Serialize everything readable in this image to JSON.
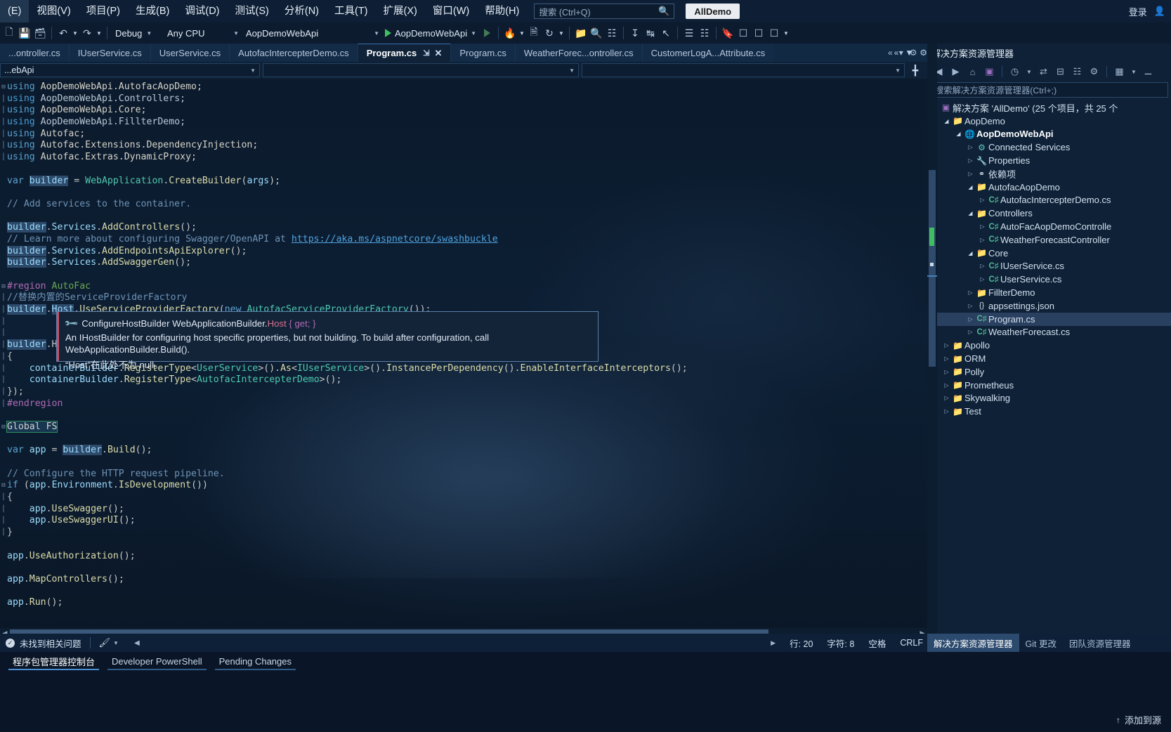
{
  "menu": {
    "items": [
      "(E)",
      "视图(V)",
      "项目(P)",
      "生成(B)",
      "调试(D)",
      "测试(S)",
      "分析(N)",
      "工具(T)",
      "扩展(X)",
      "窗口(W)",
      "帮助(H)"
    ],
    "search_placeholder": "搜索 (Ctrl+Q)",
    "search_icon": "search-icon",
    "alldemo_label": "AllDemo",
    "login_label": "登录",
    "account_icon": "account-icon"
  },
  "toolbar": {
    "config": "Debug",
    "platform": "Any CPU",
    "startup_project": "AopDemoWebApi",
    "run_label": "AopDemoWebApi",
    "icons": [
      "new-file-icon",
      "save-icon",
      "save-all-icon",
      "undo-icon",
      "redo-icon",
      "start-icon",
      "start-no-debug-icon",
      "hot-reload-icon",
      "layout-icon",
      "refresh-icon",
      "folder-icon",
      "find-icon",
      "window-icon"
    ]
  },
  "tabs": [
    {
      "label": "...ontroller.cs",
      "active": false
    },
    {
      "label": "IUserService.cs",
      "active": false
    },
    {
      "label": "UserService.cs",
      "active": false
    },
    {
      "label": "AutofacIntercepterDemo.cs",
      "active": false
    },
    {
      "label": "Program.cs",
      "active": true
    },
    {
      "label": "Program.cs",
      "active": false
    },
    {
      "label": "WeatherForec...ontroller.cs",
      "active": false
    },
    {
      "label": "CustomerLogA...Attribute.cs",
      "active": false
    }
  ],
  "tab_controls": {
    "overflow": "«",
    "dropdown": "▾",
    "settings": "⚙"
  },
  "navbar": {
    "type_value": "...ebApi",
    "member_value": "",
    "method_value": "",
    "add_icon": "split-view-icon"
  },
  "code_lines": [
    {
      "glyph": "minus",
      "tokens": [
        {
          "t": "using ",
          "c": "k"
        },
        {
          "t": "AopDemoWebApi.AutofacAopDemo;",
          "c": "ns"
        }
      ]
    },
    {
      "glyph": "bar",
      "tokens": [
        {
          "t": "using ",
          "c": "kw2"
        },
        {
          "t": "AopDemoWebApi.Controllers;",
          "c": "ns2"
        }
      ]
    },
    {
      "glyph": "bar",
      "tokens": [
        {
          "t": "using ",
          "c": "k"
        },
        {
          "t": "AopDemoWebApi.Core;",
          "c": "ns"
        }
      ]
    },
    {
      "glyph": "bar",
      "tokens": [
        {
          "t": "using ",
          "c": "kw2"
        },
        {
          "t": "AopDemoWebApi.FillterDemo;",
          "c": "ns2"
        }
      ]
    },
    {
      "glyph": "bar",
      "tokens": [
        {
          "t": "using ",
          "c": "k"
        },
        {
          "t": "Autofac;",
          "c": "ns"
        }
      ]
    },
    {
      "glyph": "bar",
      "tokens": [
        {
          "t": "using ",
          "c": "k"
        },
        {
          "t": "Autofac.Extensions.DependencyInjection;",
          "c": "ns"
        }
      ]
    },
    {
      "glyph": "bar",
      "tokens": [
        {
          "t": "using ",
          "c": "k"
        },
        {
          "t": "Autofac.Extras.DynamicProxy;",
          "c": "ns"
        }
      ]
    },
    {
      "glyph": "",
      "tokens": []
    },
    {
      "glyph": "",
      "tokens": [
        {
          "t": "var ",
          "c": "k"
        },
        {
          "t": "builder",
          "c": "hl id"
        },
        {
          "t": " = ",
          "c": "pl"
        },
        {
          "t": "WebApplication",
          "c": "typ"
        },
        {
          "t": ".",
          "c": "pl"
        },
        {
          "t": "CreateBuilder",
          "c": "mth"
        },
        {
          "t": "(",
          "c": "pl"
        },
        {
          "t": "args",
          "c": "id"
        },
        {
          "t": ");",
          "c": "pl"
        }
      ]
    },
    {
      "glyph": "",
      "tokens": []
    },
    {
      "glyph": "",
      "tokens": [
        {
          "t": "// Add services to the container.",
          "c": "cm"
        }
      ]
    },
    {
      "glyph": "",
      "tokens": []
    },
    {
      "glyph": "",
      "tokens": [
        {
          "t": "builder",
          "c": "hl id"
        },
        {
          "t": ".",
          "c": "pl"
        },
        {
          "t": "Services",
          "c": "id"
        },
        {
          "t": ".",
          "c": "pl"
        },
        {
          "t": "AddControllers",
          "c": "mth"
        },
        {
          "t": "();",
          "c": "pl"
        }
      ]
    },
    {
      "glyph": "",
      "tokens": [
        {
          "t": "// Learn more about configuring Swagger/OpenAPI at ",
          "c": "cm"
        },
        {
          "t": "https://aka.ms/aspnetcore/swashbuckle",
          "c": "lnk"
        }
      ]
    },
    {
      "glyph": "",
      "tokens": [
        {
          "t": "builder",
          "c": "hl id"
        },
        {
          "t": ".",
          "c": "pl"
        },
        {
          "t": "Services",
          "c": "id"
        },
        {
          "t": ".",
          "c": "pl"
        },
        {
          "t": "AddEndpointsApiExplorer",
          "c": "mth"
        },
        {
          "t": "();",
          "c": "pl"
        }
      ]
    },
    {
      "glyph": "",
      "tokens": [
        {
          "t": "builder",
          "c": "hl id"
        },
        {
          "t": ".",
          "c": "pl"
        },
        {
          "t": "Services",
          "c": "id"
        },
        {
          "t": ".",
          "c": "pl"
        },
        {
          "t": "AddSwaggerGen",
          "c": "mth"
        },
        {
          "t": "();",
          "c": "pl"
        }
      ]
    },
    {
      "glyph": "",
      "tokens": []
    },
    {
      "glyph": "minus",
      "tokens": [
        {
          "t": "#region ",
          "c": "pp"
        },
        {
          "t": "AutoFac",
          "c": "ppg"
        }
      ]
    },
    {
      "glyph": "bar",
      "tokens": [
        {
          "t": "//替换内置的ServiceProviderFactory",
          "c": "cm"
        }
      ]
    },
    {
      "glyph": "bar",
      "tokens": [
        {
          "t": "builder",
          "c": "hl id"
        },
        {
          "t": ".",
          "c": "pl"
        },
        {
          "t": "Host",
          "c": "hl id"
        },
        {
          "t": ".",
          "c": "pl"
        },
        {
          "t": "UseServiceProviderFactory",
          "c": "mth"
        },
        {
          "t": "(",
          "c": "pl"
        },
        {
          "t": "new ",
          "c": "k"
        },
        {
          "t": "AutofacServiceProviderFactory",
          "c": "typ"
        },
        {
          "t": "());",
          "c": "pl"
        }
      ]
    },
    {
      "glyph": "bar",
      "tokens": []
    },
    {
      "glyph": "bar",
      "tokens": []
    },
    {
      "glyph": "bar",
      "tokens": [
        {
          "t": "builder",
          "c": "hl id"
        },
        {
          "t": ".H",
          "c": "pl"
        }
      ]
    },
    {
      "glyph": "bar",
      "tokens": [
        {
          "t": "{",
          "c": "pl"
        }
      ]
    },
    {
      "glyph": "bar",
      "tokens": [
        {
          "t": "    containerBuilder",
          "c": "id"
        },
        {
          "t": ".",
          "c": "pl"
        },
        {
          "t": "RegisterType",
          "c": "mth"
        },
        {
          "t": "<",
          "c": "pl"
        },
        {
          "t": "UserService",
          "c": "typ"
        },
        {
          "t": ">().",
          "c": "pl"
        },
        {
          "t": "As",
          "c": "mth"
        },
        {
          "t": "<",
          "c": "pl"
        },
        {
          "t": "IUserService",
          "c": "typ"
        },
        {
          "t": ">().",
          "c": "pl"
        },
        {
          "t": "InstancePerDependency",
          "c": "mth"
        },
        {
          "t": "().",
          "c": "pl"
        },
        {
          "t": "EnableInterfaceInterceptors",
          "c": "mth"
        },
        {
          "t": "();",
          "c": "pl"
        }
      ]
    },
    {
      "glyph": "bar",
      "tokens": [
        {
          "t": "    containerBuilder",
          "c": "id"
        },
        {
          "t": ".",
          "c": "pl"
        },
        {
          "t": "RegisterType",
          "c": "mth"
        },
        {
          "t": "<",
          "c": "pl"
        },
        {
          "t": "AutofacIntercepterDemo",
          "c": "typ"
        },
        {
          "t": ">();",
          "c": "pl"
        }
      ]
    },
    {
      "glyph": "bar",
      "tokens": [
        {
          "t": "});",
          "c": "pl"
        }
      ]
    },
    {
      "glyph": "bar",
      "tokens": [
        {
          "t": "#endregion",
          "c": "pp"
        }
      ]
    },
    {
      "glyph": "",
      "tokens": []
    },
    {
      "glyph": "minus",
      "tokens": [
        {
          "t": "Global FS",
          "c": "sel"
        }
      ]
    },
    {
      "glyph": "",
      "tokens": []
    },
    {
      "glyph": "",
      "tokens": [
        {
          "t": "var ",
          "c": "k"
        },
        {
          "t": "app",
          "c": "id"
        },
        {
          "t": " = ",
          "c": "pl"
        },
        {
          "t": "builder",
          "c": "hl id"
        },
        {
          "t": ".",
          "c": "pl"
        },
        {
          "t": "Build",
          "c": "mth"
        },
        {
          "t": "();",
          "c": "pl"
        }
      ]
    },
    {
      "glyph": "",
      "tokens": []
    },
    {
      "glyph": "",
      "tokens": [
        {
          "t": "// Configure the HTTP request pipeline.",
          "c": "cm"
        }
      ]
    },
    {
      "glyph": "minus",
      "tokens": [
        {
          "t": "if ",
          "c": "k"
        },
        {
          "t": "(",
          "c": "pl"
        },
        {
          "t": "app",
          "c": "id"
        },
        {
          "t": ".",
          "c": "pl"
        },
        {
          "t": "Environment",
          "c": "id"
        },
        {
          "t": ".",
          "c": "pl"
        },
        {
          "t": "IsDevelopment",
          "c": "mth"
        },
        {
          "t": "())",
          "c": "pl"
        }
      ]
    },
    {
      "glyph": "bar",
      "tokens": [
        {
          "t": "{",
          "c": "pl"
        }
      ]
    },
    {
      "glyph": "bar",
      "tokens": [
        {
          "t": "    app",
          "c": "id"
        },
        {
          "t": ".",
          "c": "pl"
        },
        {
          "t": "UseSwagger",
          "c": "mth"
        },
        {
          "t": "();",
          "c": "pl"
        }
      ]
    },
    {
      "glyph": "bar",
      "tokens": [
        {
          "t": "    app",
          "c": "id"
        },
        {
          "t": ".",
          "c": "pl"
        },
        {
          "t": "UseSwaggerUI",
          "c": "mth"
        },
        {
          "t": "();",
          "c": "pl"
        }
      ]
    },
    {
      "glyph": "bar",
      "tokens": [
        {
          "t": "}",
          "c": "pl"
        }
      ]
    },
    {
      "glyph": "",
      "tokens": []
    },
    {
      "glyph": "",
      "tokens": [
        {
          "t": "app",
          "c": "id"
        },
        {
          "t": ".",
          "c": "pl"
        },
        {
          "t": "UseAuthorization",
          "c": "mth"
        },
        {
          "t": "();",
          "c": "pl"
        }
      ]
    },
    {
      "glyph": "",
      "tokens": []
    },
    {
      "glyph": "",
      "tokens": [
        {
          "t": "app",
          "c": "id"
        },
        {
          "t": ".",
          "c": "pl"
        },
        {
          "t": "MapControllers",
          "c": "mth"
        },
        {
          "t": "();",
          "c": "pl"
        }
      ]
    },
    {
      "glyph": "",
      "tokens": []
    },
    {
      "glyph": "",
      "tokens": [
        {
          "t": "app",
          "c": "id"
        },
        {
          "t": ".",
          "c": "pl"
        },
        {
          "t": "Run",
          "c": "mth"
        },
        {
          "t": "();",
          "c": "pl"
        }
      ]
    }
  ],
  "tooltip": {
    "icon": "wrench-icon",
    "signature_prefix": "ConfigureHostBuilder WebApplicationBuilder.",
    "signature_host": "Host",
    "signature_get": "{ get; }",
    "description": "An IHostBuilder for configuring host specific properties, but not building. To build after configuration, call WebApplicationBuilder.Build().",
    "note": "“Host”在此处不为 null。"
  },
  "solution_explorer": {
    "title": "解决方案资源管理器",
    "search_placeholder": "搜索解决方案资源管理器(Ctrl+;)",
    "toolbar_icons": [
      "back-icon",
      "forward-icon",
      "home-icon",
      "sync-with-active-document-icon",
      "pending-changes-icon",
      "collapse-all-icon",
      "properties-icon",
      "show-all-files-icon"
    ],
    "dock_icons": [
      "collapse-pane-icon",
      "dropdown-icon",
      "gear-icon"
    ],
    "tree": [
      {
        "level": 0,
        "arrow": "none",
        "icon": "solution-icon",
        "icon_class": "ico-sln",
        "label": "解决方案 'AllDemo' (25 个项目，共 25 个",
        "bold": false,
        "selected": false
      },
      {
        "level": 1,
        "arrow": "open",
        "icon": "folder-icon",
        "icon_class": "ico-folder",
        "label": "AopDemo",
        "bold": false,
        "selected": false
      },
      {
        "level": 2,
        "arrow": "open",
        "icon": "project-icon",
        "icon_class": "ico-web",
        "label": "AopDemoWebApi",
        "bold": true,
        "selected": false
      },
      {
        "level": 3,
        "arrow": "closed",
        "icon": "connected-services-icon",
        "icon_class": "ico-conn",
        "label": "Connected Services",
        "bold": false,
        "selected": false
      },
      {
        "level": 3,
        "arrow": "closed",
        "icon": "properties-icon",
        "icon_class": "ico-prop",
        "label": "Properties",
        "bold": false,
        "selected": false
      },
      {
        "level": 3,
        "arrow": "closed",
        "icon": "dependencies-icon",
        "icon_class": "ico-dep",
        "label": "依赖项",
        "bold": false,
        "selected": false
      },
      {
        "level": 3,
        "arrow": "open",
        "icon": "folder-icon",
        "icon_class": "ico-folder",
        "label": "AutofacAopDemo",
        "bold": false,
        "selected": false
      },
      {
        "level": 4,
        "arrow": "closed",
        "icon": "csharp-icon",
        "icon_class": "ico-cs",
        "label": "AutofacIntercepterDemo.cs",
        "bold": false,
        "selected": false
      },
      {
        "level": 3,
        "arrow": "open",
        "icon": "folder-icon",
        "icon_class": "ico-folder",
        "label": "Controllers",
        "bold": false,
        "selected": false
      },
      {
        "level": 4,
        "arrow": "closed",
        "icon": "csharp-icon",
        "icon_class": "ico-cs",
        "label": "AutoFacAopDemoControlle",
        "bold": false,
        "selected": false
      },
      {
        "level": 4,
        "arrow": "closed",
        "icon": "csharp-icon",
        "icon_class": "ico-cs",
        "label": "WeatherForecastController",
        "bold": false,
        "selected": false
      },
      {
        "level": 3,
        "arrow": "open",
        "icon": "folder-icon",
        "icon_class": "ico-folder",
        "label": "Core",
        "bold": false,
        "selected": false
      },
      {
        "level": 4,
        "arrow": "closed",
        "icon": "csharp-icon",
        "icon_class": "ico-cs",
        "label": "IUserService.cs",
        "bold": false,
        "selected": false
      },
      {
        "level": 4,
        "arrow": "closed",
        "icon": "csharp-icon",
        "icon_class": "ico-cs",
        "label": "UserService.cs",
        "bold": false,
        "selected": false
      },
      {
        "level": 3,
        "arrow": "closed",
        "icon": "folder-icon",
        "icon_class": "ico-folder",
        "label": "FillterDemo",
        "bold": false,
        "selected": false
      },
      {
        "level": 3,
        "arrow": "closed",
        "icon": "json-icon",
        "icon_class": "ico-json",
        "label": "appsettings.json",
        "bold": false,
        "selected": false
      },
      {
        "level": 3,
        "arrow": "closed",
        "icon": "csharp-icon",
        "icon_class": "ico-cs",
        "label": "Program.cs",
        "bold": false,
        "selected": true
      },
      {
        "level": 3,
        "arrow": "closed",
        "icon": "csharp-icon",
        "icon_class": "ico-cs",
        "label": "WeatherForecast.cs",
        "bold": false,
        "selected": false
      },
      {
        "level": 1,
        "arrow": "closed",
        "icon": "folder-icon",
        "icon_class": "ico-folder",
        "label": "Apollo",
        "bold": false,
        "selected": false
      },
      {
        "level": 1,
        "arrow": "closed",
        "icon": "folder-icon",
        "icon_class": "ico-folder",
        "label": "ORM",
        "bold": false,
        "selected": false
      },
      {
        "level": 1,
        "arrow": "closed",
        "icon": "folder-icon",
        "icon_class": "ico-folder",
        "label": "Polly",
        "bold": false,
        "selected": false
      },
      {
        "level": 1,
        "arrow": "closed",
        "icon": "folder-icon",
        "icon_class": "ico-folder",
        "label": "Prometheus",
        "bold": false,
        "selected": false
      },
      {
        "level": 1,
        "arrow": "closed",
        "icon": "folder-icon",
        "icon_class": "ico-folder",
        "label": "Skywalking",
        "bold": false,
        "selected": false
      },
      {
        "level": 1,
        "arrow": "closed",
        "icon": "folder-icon",
        "icon_class": "ico-folder",
        "label": "Test",
        "bold": false,
        "selected": false
      }
    ]
  },
  "statusbar": {
    "issue_text": "未找到相关问题",
    "check_icon": "check-circle-icon",
    "brush_icon": "paintbrush-icon",
    "nav_arrow": "◀",
    "right_arrow": "▶",
    "line": "行: 20",
    "char": "字符: 8",
    "spaces": "空格",
    "eol": "CRLF"
  },
  "panel_tabs": [
    {
      "label": "解决方案资源管理器",
      "active": true
    },
    {
      "label": "Git 更改",
      "active": false
    },
    {
      "label": "团队资源管理器",
      "active": false
    }
  ],
  "bottom_tabs": [
    {
      "label": "程序包管理器控制台",
      "state": "active"
    },
    {
      "label": "Developer PowerShell",
      "state": "underline"
    },
    {
      "label": "Pending Changes",
      "state": "underline"
    }
  ],
  "bottom_footer": {
    "label": "添加到源",
    "icon": "upload-icon"
  }
}
